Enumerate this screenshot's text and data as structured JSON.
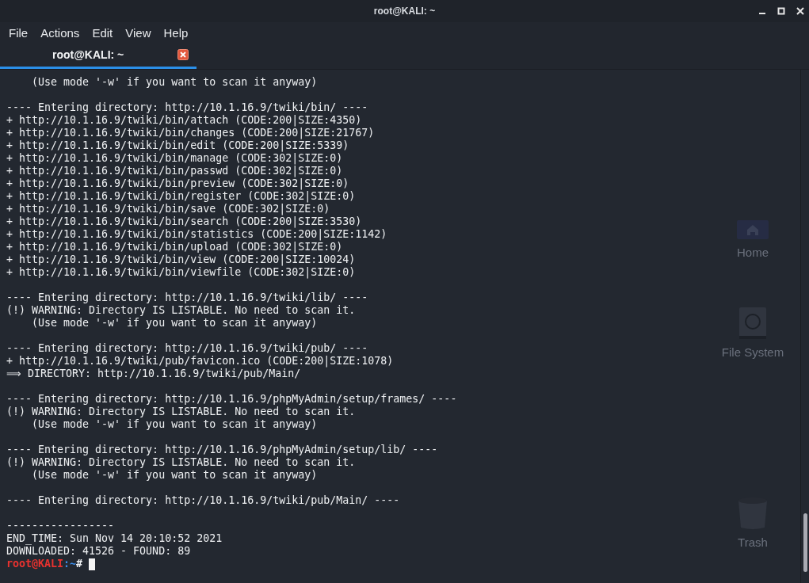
{
  "window": {
    "title": "root@KALI: ~"
  },
  "menu": [
    "File",
    "Actions",
    "Edit",
    "View",
    "Help"
  ],
  "tabs": [
    {
      "label": "root@KALI: ~",
      "selected": true
    }
  ],
  "desktop_icons": [
    {
      "kind": "home",
      "label": "Home"
    },
    {
      "kind": "drive",
      "label": "File System"
    },
    {
      "kind": "trash",
      "label": "Trash"
    }
  ],
  "terminal": {
    "blocks": [
      [
        "    (Use mode '-w' if you want to scan it anyway)"
      ],
      [
        "---- Entering directory: http://10.1.16.9/twiki/bin/ ----",
        "+ http://10.1.16.9/twiki/bin/attach (CODE:200|SIZE:4350)",
        "+ http://10.1.16.9/twiki/bin/changes (CODE:200|SIZE:21767)",
        "+ http://10.1.16.9/twiki/bin/edit (CODE:200|SIZE:5339)",
        "+ http://10.1.16.9/twiki/bin/manage (CODE:302|SIZE:0)",
        "+ http://10.1.16.9/twiki/bin/passwd (CODE:302|SIZE:0)",
        "+ http://10.1.16.9/twiki/bin/preview (CODE:302|SIZE:0)",
        "+ http://10.1.16.9/twiki/bin/register (CODE:302|SIZE:0)",
        "+ http://10.1.16.9/twiki/bin/save (CODE:302|SIZE:0)",
        "+ http://10.1.16.9/twiki/bin/search (CODE:200|SIZE:3530)",
        "+ http://10.1.16.9/twiki/bin/statistics (CODE:200|SIZE:1142)",
        "+ http://10.1.16.9/twiki/bin/upload (CODE:302|SIZE:0)",
        "+ http://10.1.16.9/twiki/bin/view (CODE:200|SIZE:10024)",
        "+ http://10.1.16.9/twiki/bin/viewfile (CODE:302|SIZE:0)"
      ],
      [
        "---- Entering directory: http://10.1.16.9/twiki/lib/ ----",
        "(!) WARNING: Directory IS LISTABLE. No need to scan it.",
        "    (Use mode '-w' if you want to scan it anyway)"
      ],
      [
        "---- Entering directory: http://10.1.16.9/twiki/pub/ ----",
        "+ http://10.1.16.9/twiki/pub/favicon.ico (CODE:200|SIZE:1078)",
        "⟹ DIRECTORY: http://10.1.16.9/twiki/pub/Main/"
      ],
      [
        "---- Entering directory: http://10.1.16.9/phpMyAdmin/setup/frames/ ----",
        "(!) WARNING: Directory IS LISTABLE. No need to scan it.",
        "    (Use mode '-w' if you want to scan it anyway)"
      ],
      [
        "---- Entering directory: http://10.1.16.9/phpMyAdmin/setup/lib/ ----",
        "(!) WARNING: Directory IS LISTABLE. No need to scan it.",
        "    (Use mode '-w' if you want to scan it anyway)"
      ],
      [
        "---- Entering directory: http://10.1.16.9/twiki/pub/Main/ ----"
      ],
      [
        "-----------------",
        "END_TIME: Sun Nov 14 20:10:52 2021",
        "DOWNLOADED: 41526 - FOUND: 89"
      ]
    ],
    "prompt": {
      "user": "root@KALI",
      "path": ":~",
      "symbol": "#"
    }
  }
}
